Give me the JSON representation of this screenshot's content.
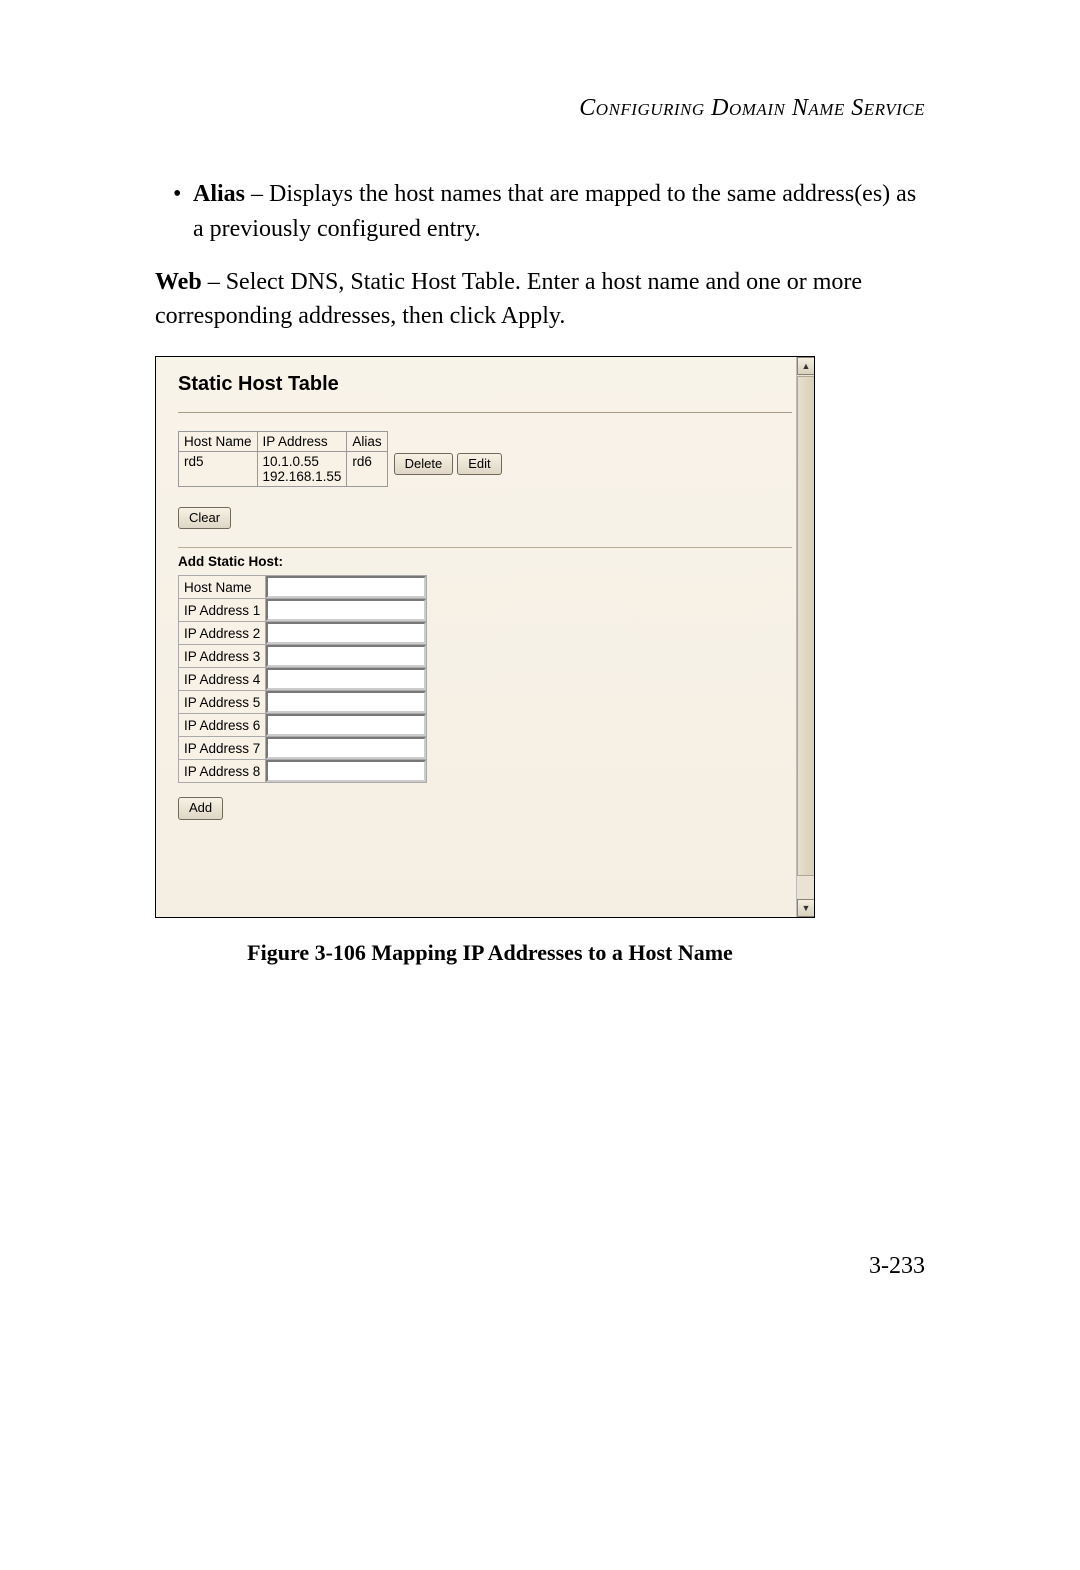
{
  "header": "Configuring Domain Name Service",
  "bullet": {
    "term": "Alias",
    "desc": " – Displays the host names that are mapped to the same address(es) as a previously configured entry."
  },
  "web_para": {
    "term": "Web",
    "desc": " – Select DNS, Static Host Table. Enter a host name and one or more corresponding addresses, then click Apply."
  },
  "panel": {
    "title": "Static Host Table",
    "table": {
      "headers": [
        "Host Name",
        "IP Address",
        "Alias"
      ],
      "row": {
        "host": "rd5",
        "ips": "10.1.0.55\n192.168.1.55",
        "alias": "rd6"
      },
      "delete_btn": "Delete",
      "edit_btn": "Edit"
    },
    "clear_btn": "Clear",
    "add_section": {
      "title": "Add Static Host:",
      "fields": [
        "Host Name",
        "IP Address 1",
        "IP Address 2",
        "IP Address 3",
        "IP Address 4",
        "IP Address 5",
        "IP Address 6",
        "IP Address 7",
        "IP Address 8"
      ],
      "add_btn": "Add"
    }
  },
  "figure_caption": "Figure 3-106  Mapping IP Addresses to a Host Name",
  "page_number": "3-233"
}
